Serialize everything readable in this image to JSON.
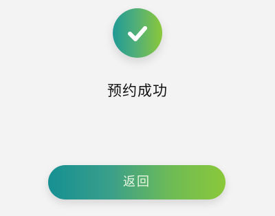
{
  "success": {
    "icon": "check-icon",
    "title": "预约成功"
  },
  "actions": {
    "back_label": "返回"
  },
  "colors": {
    "page_bg": "#f3f3f3",
    "gradient_start": "#169093",
    "gradient_end": "#8bc83a",
    "title_text": "#111111",
    "button_text": "#e9f7e2"
  }
}
